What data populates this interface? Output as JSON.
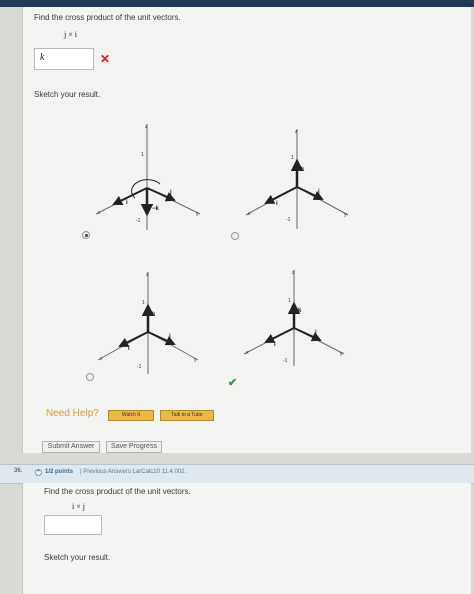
{
  "question1": {
    "prompt": "Find the cross product of the unit vectors.",
    "expression": "j × i",
    "answer": "k",
    "result": "incorrect",
    "sketch_prompt": "Sketch your result."
  },
  "axis_labels": {
    "z": "z",
    "x": "x",
    "y": "y",
    "i": "i",
    "j": "j",
    "k": "k",
    "pos1": "1",
    "neg1": "-1",
    "negk": "−k"
  },
  "options": [
    {
      "selected": true,
      "correct": false
    },
    {
      "selected": false,
      "correct": false
    },
    {
      "selected": false,
      "correct": false
    },
    {
      "selected": false,
      "correct": true
    }
  ],
  "help": {
    "label": "Need Help?",
    "watch_it": "Watch It",
    "talk_to_tutor": "Talk to a Tutor"
  },
  "buttons": {
    "submit": "Submit Answer",
    "save": "Save Progress"
  },
  "question2": {
    "number": "36.",
    "points": "1/2 points",
    "meta": "| Previous Answers  LarCalc10 11.4.002.",
    "prompt": "Find the cross product of the unit vectors.",
    "expression": "i × j",
    "answer": "",
    "sketch_prompt": "Sketch your result."
  },
  "colors": {
    "top_bar": "#1f3b57",
    "correct": "#2f9a3a",
    "incorrect": "#d02020",
    "help_accent": "#e39c2c"
  }
}
